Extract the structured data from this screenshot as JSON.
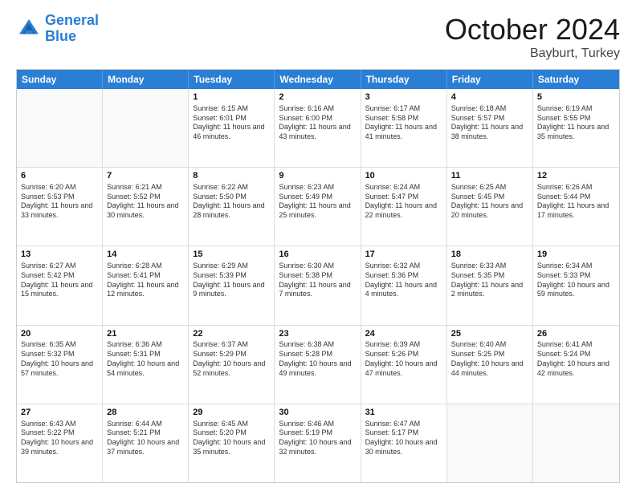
{
  "header": {
    "logo_general": "General",
    "logo_blue": "Blue",
    "month": "October 2024",
    "location": "Bayburt, Turkey"
  },
  "weekdays": [
    "Sunday",
    "Monday",
    "Tuesday",
    "Wednesday",
    "Thursday",
    "Friday",
    "Saturday"
  ],
  "rows": [
    [
      {
        "day": "",
        "sunrise": "",
        "sunset": "",
        "daylight": ""
      },
      {
        "day": "",
        "sunrise": "",
        "sunset": "",
        "daylight": ""
      },
      {
        "day": "1",
        "sunrise": "Sunrise: 6:15 AM",
        "sunset": "Sunset: 6:01 PM",
        "daylight": "Daylight: 11 hours and 46 minutes."
      },
      {
        "day": "2",
        "sunrise": "Sunrise: 6:16 AM",
        "sunset": "Sunset: 6:00 PM",
        "daylight": "Daylight: 11 hours and 43 minutes."
      },
      {
        "day": "3",
        "sunrise": "Sunrise: 6:17 AM",
        "sunset": "Sunset: 5:58 PM",
        "daylight": "Daylight: 11 hours and 41 minutes."
      },
      {
        "day": "4",
        "sunrise": "Sunrise: 6:18 AM",
        "sunset": "Sunset: 5:57 PM",
        "daylight": "Daylight: 11 hours and 38 minutes."
      },
      {
        "day": "5",
        "sunrise": "Sunrise: 6:19 AM",
        "sunset": "Sunset: 5:55 PM",
        "daylight": "Daylight: 11 hours and 35 minutes."
      }
    ],
    [
      {
        "day": "6",
        "sunrise": "Sunrise: 6:20 AM",
        "sunset": "Sunset: 5:53 PM",
        "daylight": "Daylight: 11 hours and 33 minutes."
      },
      {
        "day": "7",
        "sunrise": "Sunrise: 6:21 AM",
        "sunset": "Sunset: 5:52 PM",
        "daylight": "Daylight: 11 hours and 30 minutes."
      },
      {
        "day": "8",
        "sunrise": "Sunrise: 6:22 AM",
        "sunset": "Sunset: 5:50 PM",
        "daylight": "Daylight: 11 hours and 28 minutes."
      },
      {
        "day": "9",
        "sunrise": "Sunrise: 6:23 AM",
        "sunset": "Sunset: 5:49 PM",
        "daylight": "Daylight: 11 hours and 25 minutes."
      },
      {
        "day": "10",
        "sunrise": "Sunrise: 6:24 AM",
        "sunset": "Sunset: 5:47 PM",
        "daylight": "Daylight: 11 hours and 22 minutes."
      },
      {
        "day": "11",
        "sunrise": "Sunrise: 6:25 AM",
        "sunset": "Sunset: 5:45 PM",
        "daylight": "Daylight: 11 hours and 20 minutes."
      },
      {
        "day": "12",
        "sunrise": "Sunrise: 6:26 AM",
        "sunset": "Sunset: 5:44 PM",
        "daylight": "Daylight: 11 hours and 17 minutes."
      }
    ],
    [
      {
        "day": "13",
        "sunrise": "Sunrise: 6:27 AM",
        "sunset": "Sunset: 5:42 PM",
        "daylight": "Daylight: 11 hours and 15 minutes."
      },
      {
        "day": "14",
        "sunrise": "Sunrise: 6:28 AM",
        "sunset": "Sunset: 5:41 PM",
        "daylight": "Daylight: 11 hours and 12 minutes."
      },
      {
        "day": "15",
        "sunrise": "Sunrise: 6:29 AM",
        "sunset": "Sunset: 5:39 PM",
        "daylight": "Daylight: 11 hours and 9 minutes."
      },
      {
        "day": "16",
        "sunrise": "Sunrise: 6:30 AM",
        "sunset": "Sunset: 5:38 PM",
        "daylight": "Daylight: 11 hours and 7 minutes."
      },
      {
        "day": "17",
        "sunrise": "Sunrise: 6:32 AM",
        "sunset": "Sunset: 5:36 PM",
        "daylight": "Daylight: 11 hours and 4 minutes."
      },
      {
        "day": "18",
        "sunrise": "Sunrise: 6:33 AM",
        "sunset": "Sunset: 5:35 PM",
        "daylight": "Daylight: 11 hours and 2 minutes."
      },
      {
        "day": "19",
        "sunrise": "Sunrise: 6:34 AM",
        "sunset": "Sunset: 5:33 PM",
        "daylight": "Daylight: 10 hours and 59 minutes."
      }
    ],
    [
      {
        "day": "20",
        "sunrise": "Sunrise: 6:35 AM",
        "sunset": "Sunset: 5:32 PM",
        "daylight": "Daylight: 10 hours and 57 minutes."
      },
      {
        "day": "21",
        "sunrise": "Sunrise: 6:36 AM",
        "sunset": "Sunset: 5:31 PM",
        "daylight": "Daylight: 10 hours and 54 minutes."
      },
      {
        "day": "22",
        "sunrise": "Sunrise: 6:37 AM",
        "sunset": "Sunset: 5:29 PM",
        "daylight": "Daylight: 10 hours and 52 minutes."
      },
      {
        "day": "23",
        "sunrise": "Sunrise: 6:38 AM",
        "sunset": "Sunset: 5:28 PM",
        "daylight": "Daylight: 10 hours and 49 minutes."
      },
      {
        "day": "24",
        "sunrise": "Sunrise: 6:39 AM",
        "sunset": "Sunset: 5:26 PM",
        "daylight": "Daylight: 10 hours and 47 minutes."
      },
      {
        "day": "25",
        "sunrise": "Sunrise: 6:40 AM",
        "sunset": "Sunset: 5:25 PM",
        "daylight": "Daylight: 10 hours and 44 minutes."
      },
      {
        "day": "26",
        "sunrise": "Sunrise: 6:41 AM",
        "sunset": "Sunset: 5:24 PM",
        "daylight": "Daylight: 10 hours and 42 minutes."
      }
    ],
    [
      {
        "day": "27",
        "sunrise": "Sunrise: 6:43 AM",
        "sunset": "Sunset: 5:22 PM",
        "daylight": "Daylight: 10 hours and 39 minutes."
      },
      {
        "day": "28",
        "sunrise": "Sunrise: 6:44 AM",
        "sunset": "Sunset: 5:21 PM",
        "daylight": "Daylight: 10 hours and 37 minutes."
      },
      {
        "day": "29",
        "sunrise": "Sunrise: 6:45 AM",
        "sunset": "Sunset: 5:20 PM",
        "daylight": "Daylight: 10 hours and 35 minutes."
      },
      {
        "day": "30",
        "sunrise": "Sunrise: 6:46 AM",
        "sunset": "Sunset: 5:19 PM",
        "daylight": "Daylight: 10 hours and 32 minutes."
      },
      {
        "day": "31",
        "sunrise": "Sunrise: 6:47 AM",
        "sunset": "Sunset: 5:17 PM",
        "daylight": "Daylight: 10 hours and 30 minutes."
      },
      {
        "day": "",
        "sunrise": "",
        "sunset": "",
        "daylight": ""
      },
      {
        "day": "",
        "sunrise": "",
        "sunset": "",
        "daylight": ""
      }
    ]
  ]
}
